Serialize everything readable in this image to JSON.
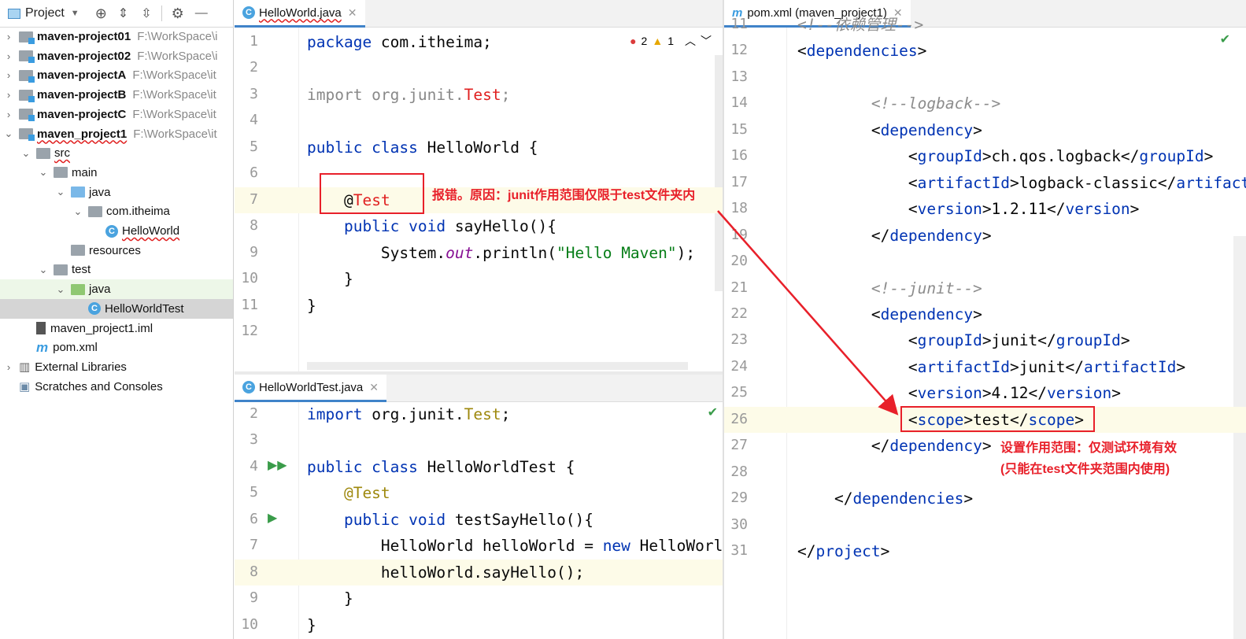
{
  "project_panel": {
    "title": "Project",
    "items": [
      {
        "label": "maven-project01",
        "path": "F:\\WorkSpace\\i",
        "bold": true,
        "depth": 0,
        "chev": "›",
        "icon": "module"
      },
      {
        "label": "maven-project02",
        "path": "F:\\WorkSpace\\i",
        "bold": true,
        "depth": 0,
        "chev": "›",
        "icon": "module"
      },
      {
        "label": "maven-projectA",
        "path": "F:\\WorkSpace\\it",
        "bold": true,
        "depth": 0,
        "chev": "›",
        "icon": "module"
      },
      {
        "label": "maven-projectB",
        "path": "F:\\WorkSpace\\it",
        "bold": true,
        "depth": 0,
        "chev": "›",
        "icon": "module"
      },
      {
        "label": "maven-projectC",
        "path": "F:\\WorkSpace\\it",
        "bold": true,
        "depth": 0,
        "chev": "›",
        "icon": "module"
      },
      {
        "label": "maven_project1",
        "path": "F:\\WorkSpace\\it",
        "bold": true,
        "depth": 0,
        "chev": "⌄",
        "icon": "module"
      },
      {
        "label": "src",
        "depth": 1,
        "chev": "⌄",
        "icon": "folder"
      },
      {
        "label": "main",
        "depth": 2,
        "chev": "⌄",
        "icon": "folder"
      },
      {
        "label": "java",
        "depth": 3,
        "chev": "⌄",
        "icon": "folder-blue"
      },
      {
        "label": "com.itheima",
        "depth": 4,
        "chev": "⌄",
        "icon": "package"
      },
      {
        "label": "HelloWorld",
        "depth": 5,
        "chev": "",
        "icon": "class"
      },
      {
        "label": "resources",
        "depth": 3,
        "chev": "",
        "icon": "folder"
      },
      {
        "label": "test",
        "depth": 2,
        "chev": "⌄",
        "icon": "folder"
      },
      {
        "label": "java",
        "depth": 3,
        "chev": "⌄",
        "icon": "folder-green"
      },
      {
        "label": "HelloWorldTest",
        "depth": 4,
        "chev": "",
        "icon": "class",
        "selected": true
      },
      {
        "label": "maven_project1.iml",
        "depth": 1,
        "chev": "",
        "icon": "file"
      },
      {
        "label": "pom.xml",
        "depth": 1,
        "chev": "",
        "icon": "maven"
      },
      {
        "label": "External Libraries",
        "depth": 0,
        "chev": "›",
        "icon": "libs"
      },
      {
        "label": "Scratches and Consoles",
        "depth": 0,
        "chev": "",
        "icon": "scratch"
      }
    ]
  },
  "editor_main": {
    "tab": "HelloWorld.java",
    "errors": "2",
    "warnings": "1",
    "start": 1,
    "lines": [
      [
        [
          "kw",
          "package "
        ],
        [
          "",
          "com.itheima;"
        ]
      ],
      [],
      [
        [
          "gray",
          "import org.junit."
        ],
        [
          "err",
          "Test"
        ],
        [
          "gray",
          ";"
        ]
      ],
      [],
      [
        [
          "kw",
          "public class "
        ],
        [
          "",
          "HelloWorld {"
        ]
      ],
      [],
      [
        [
          "",
          "    "
        ],
        [
          "",
          "@"
        ],
        [
          "err",
          "Test"
        ]
      ],
      [
        [
          "",
          "    "
        ],
        [
          "kw",
          "public void "
        ],
        [
          "",
          "sayHello(){"
        ]
      ],
      [
        [
          "",
          "        System."
        ],
        [
          "it",
          "out"
        ],
        [
          "",
          "."
        ],
        [
          "",
          "println("
        ],
        [
          "str",
          "\"Hello Maven\""
        ],
        [
          "",
          ");"
        ]
      ],
      [
        [
          "",
          "    }"
        ]
      ],
      [
        [
          "",
          "}"
        ]
      ],
      []
    ]
  },
  "editor_test": {
    "tab": "HelloWorldTest.java",
    "start": 2,
    "lines": [
      [
        [
          "kw",
          "import "
        ],
        [
          "",
          "org.junit."
        ],
        [
          "ann",
          "Test"
        ],
        [
          "",
          ";"
        ]
      ],
      [],
      [
        [
          "kw",
          "public class "
        ],
        [
          "",
          "HelloWorldTest {"
        ]
      ],
      [
        [
          "ann",
          "    @Test"
        ]
      ],
      [
        [
          "",
          "    "
        ],
        [
          "kw",
          "public void "
        ],
        [
          "",
          "testSayHello(){"
        ]
      ],
      [
        [
          "",
          "        HelloWorld helloWorld = "
        ],
        [
          "kw",
          "new "
        ],
        [
          "",
          "HelloWorld();"
        ]
      ],
      [
        [
          "",
          "        helloWorld.sayHello();"
        ]
      ],
      [
        [
          "",
          "    }"
        ]
      ],
      [
        [
          "",
          "}"
        ]
      ]
    ]
  },
  "editor_pom": {
    "tab": "pom.xml (maven_project1)",
    "start": 11,
    "lines": [
      [
        [
          "cm",
          "<!--依赖管理-->"
        ]
      ],
      [
        [
          "",
          "<"
        ],
        [
          "tag",
          "dependencies"
        ],
        [
          "",
          ">"
        ]
      ],
      [],
      [
        [
          "cm",
          "        <!--logback-->"
        ]
      ],
      [
        [
          "",
          "        <"
        ],
        [
          "tag",
          "dependency"
        ],
        [
          "",
          ">"
        ]
      ],
      [
        [
          "",
          "            <"
        ],
        [
          "tag",
          "groupId"
        ],
        [
          "",
          ">ch.qos.logback</"
        ],
        [
          "tag",
          "groupId"
        ],
        [
          "",
          ">"
        ]
      ],
      [
        [
          "",
          "            <"
        ],
        [
          "tag",
          "artifactId"
        ],
        [
          "",
          ">logback-classic</"
        ],
        [
          "tag",
          "artifactId"
        ],
        [
          "",
          ">"
        ]
      ],
      [
        [
          "",
          "            <"
        ],
        [
          "tag",
          "version"
        ],
        [
          "",
          ">1.2.11</"
        ],
        [
          "tag",
          "version"
        ],
        [
          "",
          ">"
        ]
      ],
      [
        [
          "",
          "        </"
        ],
        [
          "tag",
          "dependency"
        ],
        [
          "",
          ">"
        ]
      ],
      [],
      [
        [
          "cm",
          "        <!--junit-->"
        ]
      ],
      [
        [
          "",
          "        <"
        ],
        [
          "tag",
          "dependency"
        ],
        [
          "",
          ">"
        ]
      ],
      [
        [
          "",
          "            <"
        ],
        [
          "tag",
          "groupId"
        ],
        [
          "",
          ">junit</"
        ],
        [
          "tag",
          "groupId"
        ],
        [
          "",
          ">"
        ]
      ],
      [
        [
          "",
          "            <"
        ],
        [
          "tag",
          "artifactId"
        ],
        [
          "",
          ">junit</"
        ],
        [
          "tag",
          "artifactId"
        ],
        [
          "",
          ">"
        ]
      ],
      [
        [
          "",
          "            <"
        ],
        [
          "tag",
          "version"
        ],
        [
          "",
          ">4.12</"
        ],
        [
          "tag",
          "version"
        ],
        [
          "",
          ">"
        ]
      ],
      [
        [
          "",
          "            <"
        ],
        [
          "tag",
          "scope"
        ],
        [
          "",
          ">test</"
        ],
        [
          "tag",
          "scope"
        ],
        [
          "",
          ">"
        ]
      ],
      [
        [
          "",
          "        </"
        ],
        [
          "tag",
          "dependency"
        ],
        [
          "",
          ">"
        ]
      ],
      [],
      [
        [
          "",
          "    </"
        ],
        [
          "tag",
          "dependencies"
        ],
        [
          "",
          ">"
        ]
      ],
      [],
      [
        [
          "",
          "</"
        ],
        [
          "tag",
          "project"
        ],
        [
          "",
          ">"
        ]
      ]
    ]
  },
  "annotations": {
    "error_note": "报错。原因：junit作用范围仅限于test文件夹内",
    "scope_note_1": "设置作用范围：仅测试环境有效",
    "scope_note_2": "(只能在test文件夹范围内使用)",
    "color": "#e8202a"
  }
}
